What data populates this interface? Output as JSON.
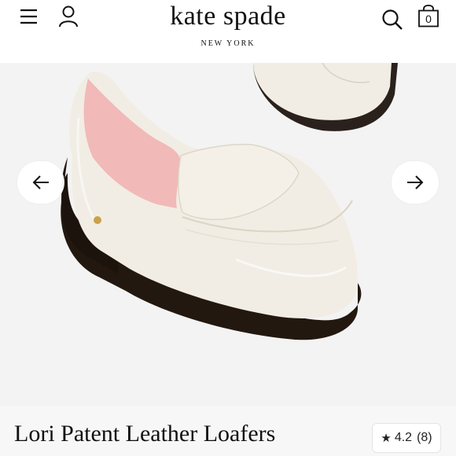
{
  "header": {
    "brand_name": "kate spade",
    "brand_sub": "NEW YORK",
    "cart_count": "0",
    "icons": [
      "menu-icon",
      "account-icon",
      "search-icon",
      "shopping-bag-icon"
    ]
  },
  "carousel": {
    "image_alt": "Lori Patent Leather Loafers",
    "prev_icon": "arrow-left-icon",
    "next_icon": "arrow-right-icon"
  },
  "product": {
    "title": "Lori Patent Leather Loafers",
    "rating_star": "★",
    "rating": "4.2",
    "review_count": "(8)"
  },
  "colors": {
    "accent": "#111111",
    "background": "#f3f3f3",
    "shoe": "#f1ede4",
    "lining": "#f1b9b7"
  }
}
